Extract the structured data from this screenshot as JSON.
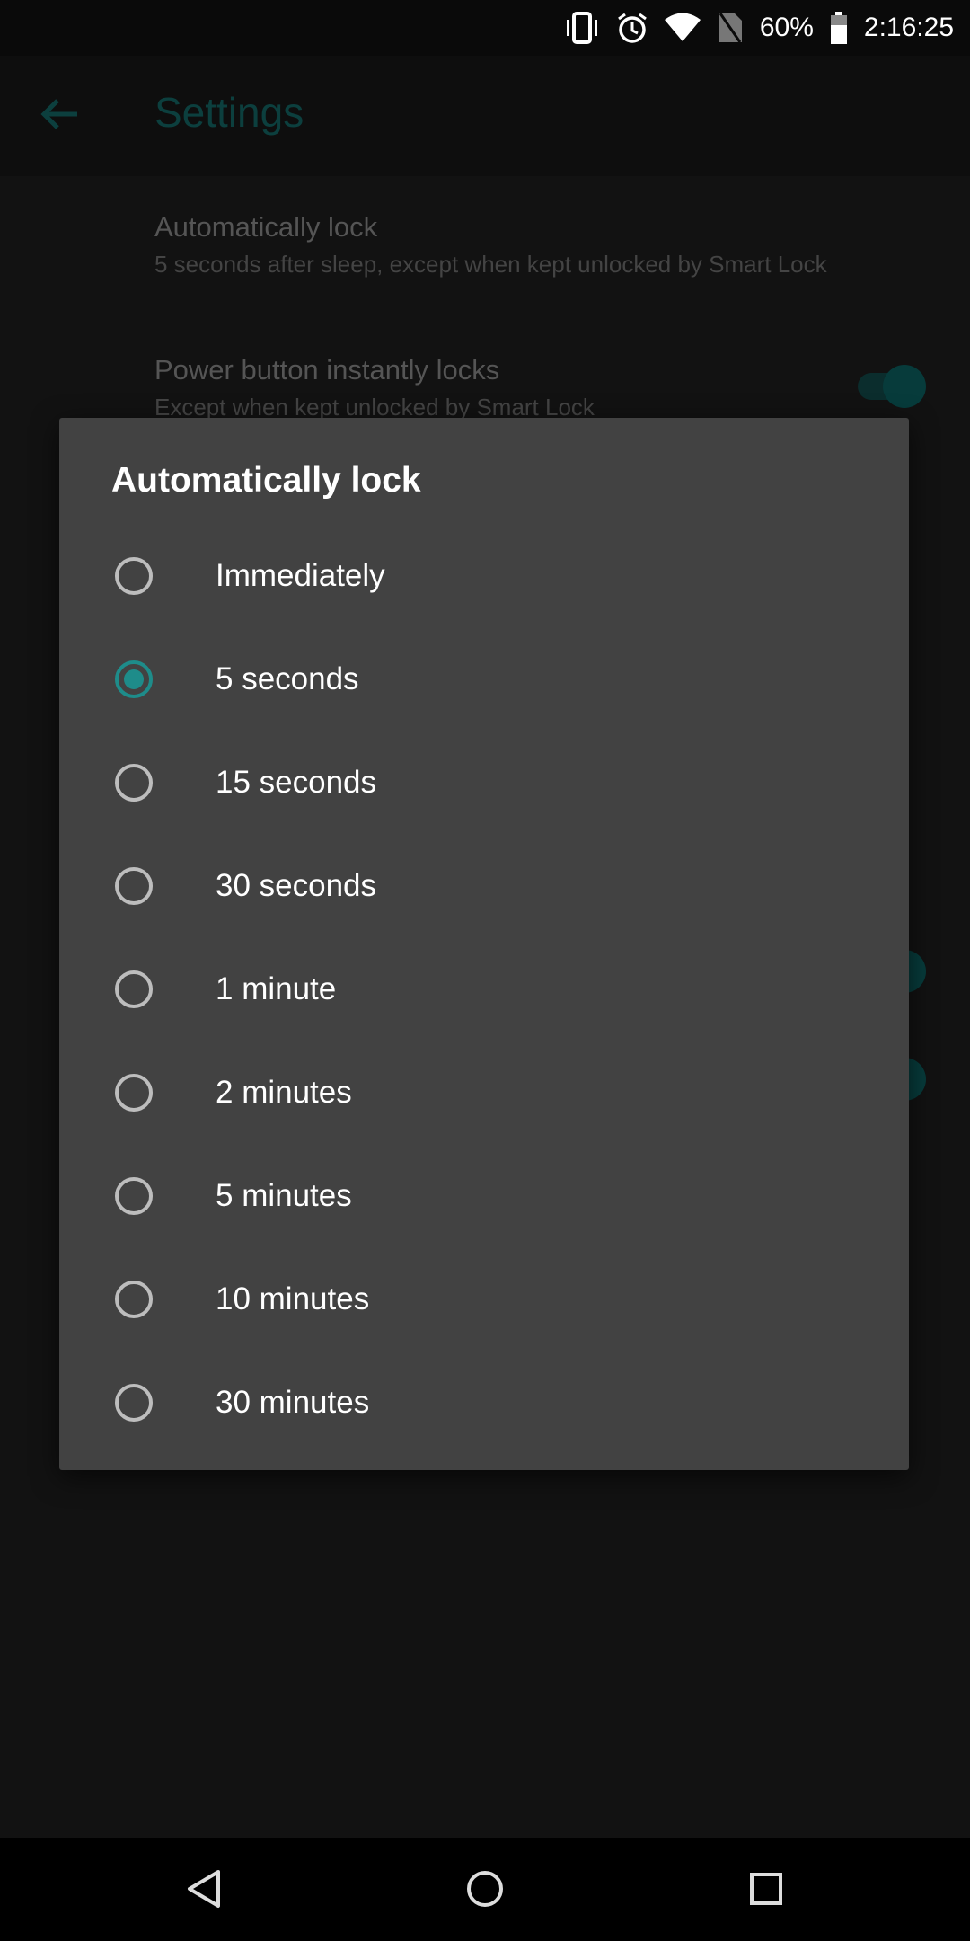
{
  "status_bar": {
    "battery": "60%",
    "time": "2:16:25",
    "icons": [
      "vibrate-icon",
      "alarm-icon",
      "wifi-icon",
      "no-sim-icon",
      "battery-icon"
    ]
  },
  "toolbar": {
    "title": "Settings"
  },
  "background_prefs": [
    {
      "title": "Automatically lock",
      "summary": "5 seconds after sleep, except when kept unlocked by Smart Lock"
    },
    {
      "title": "Power button instantly locks",
      "summary": "Except when kept unlocked by Smart Lock",
      "toggle_on": true
    }
  ],
  "dialog": {
    "title": "Automatically lock",
    "selected_index": 1,
    "accent": "#1e8c8a",
    "options": [
      "Immediately",
      "5 seconds",
      "15 seconds",
      "30 seconds",
      "1 minute",
      "2 minutes",
      "5 minutes",
      "10 minutes",
      "30 minutes"
    ]
  },
  "nav_bar": {
    "icons": [
      "back-icon",
      "home-icon",
      "recents-icon"
    ]
  }
}
